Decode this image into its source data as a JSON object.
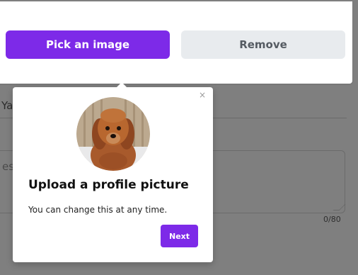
{
  "buttons": {
    "pick_image": "Pick an image",
    "remove": "Remove"
  },
  "background": {
    "name_field_text": "Ya",
    "bio_field_text": "es",
    "char_count": "0/80"
  },
  "popover": {
    "title": "Upload a profile picture",
    "body": "You can change this at any time.",
    "next_button": "Next",
    "close_glyph": "×"
  },
  "colors": {
    "accent": "#7d2ae8",
    "secondary_button": "#e8ebee",
    "backdrop": "#7f7f7f"
  }
}
